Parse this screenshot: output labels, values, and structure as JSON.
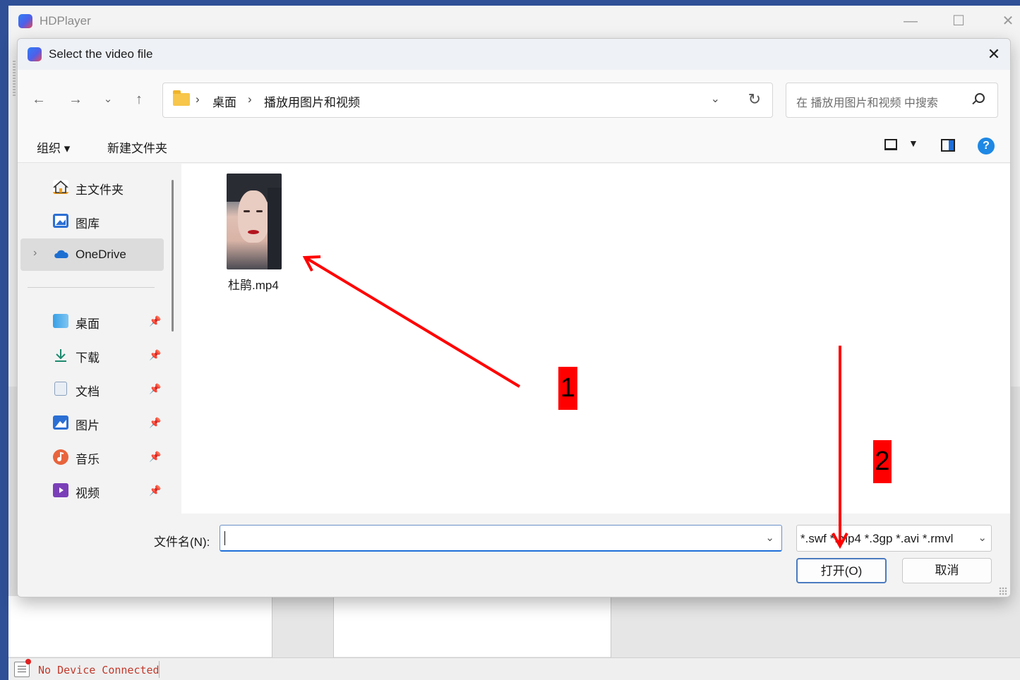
{
  "app": {
    "title": "HDPlayer",
    "status_text": "No Device Connected"
  },
  "dialog": {
    "title": "Select the video file",
    "breadcrumb": [
      "桌面",
      "播放用图片和视频"
    ],
    "search_placeholder": "在 播放用图片和视频 中搜索",
    "toolbar": {
      "organize": "组织 ▾",
      "new_folder": "新建文件夹"
    },
    "sidebar": {
      "top_items": [
        {
          "label": "主文件夹",
          "icon": "home-icon"
        },
        {
          "label": "图库",
          "icon": "gallery-icon"
        },
        {
          "label": "OneDrive",
          "icon": "onedrive-cloud-icon"
        }
      ],
      "pinned_items": [
        {
          "label": "桌面",
          "icon": "desktop-icon"
        },
        {
          "label": "下载",
          "icon": "download-icon"
        },
        {
          "label": "文档",
          "icon": "document-icon"
        },
        {
          "label": "图片",
          "icon": "pictures-icon"
        },
        {
          "label": "音乐",
          "icon": "music-icon"
        },
        {
          "label": "视频",
          "icon": "video-icon"
        }
      ]
    },
    "files": [
      {
        "name": "杜鹃.mp4"
      }
    ],
    "filename_label": "文件名(N):",
    "filename_value": "",
    "filter_value": "*.swf *.mp4 *.3gp *.avi *.rmvl",
    "open_button": "打开(O)",
    "cancel_button": "取消"
  },
  "annotations": {
    "step1": "1",
    "step2": "2",
    "color": "#ff0000"
  }
}
